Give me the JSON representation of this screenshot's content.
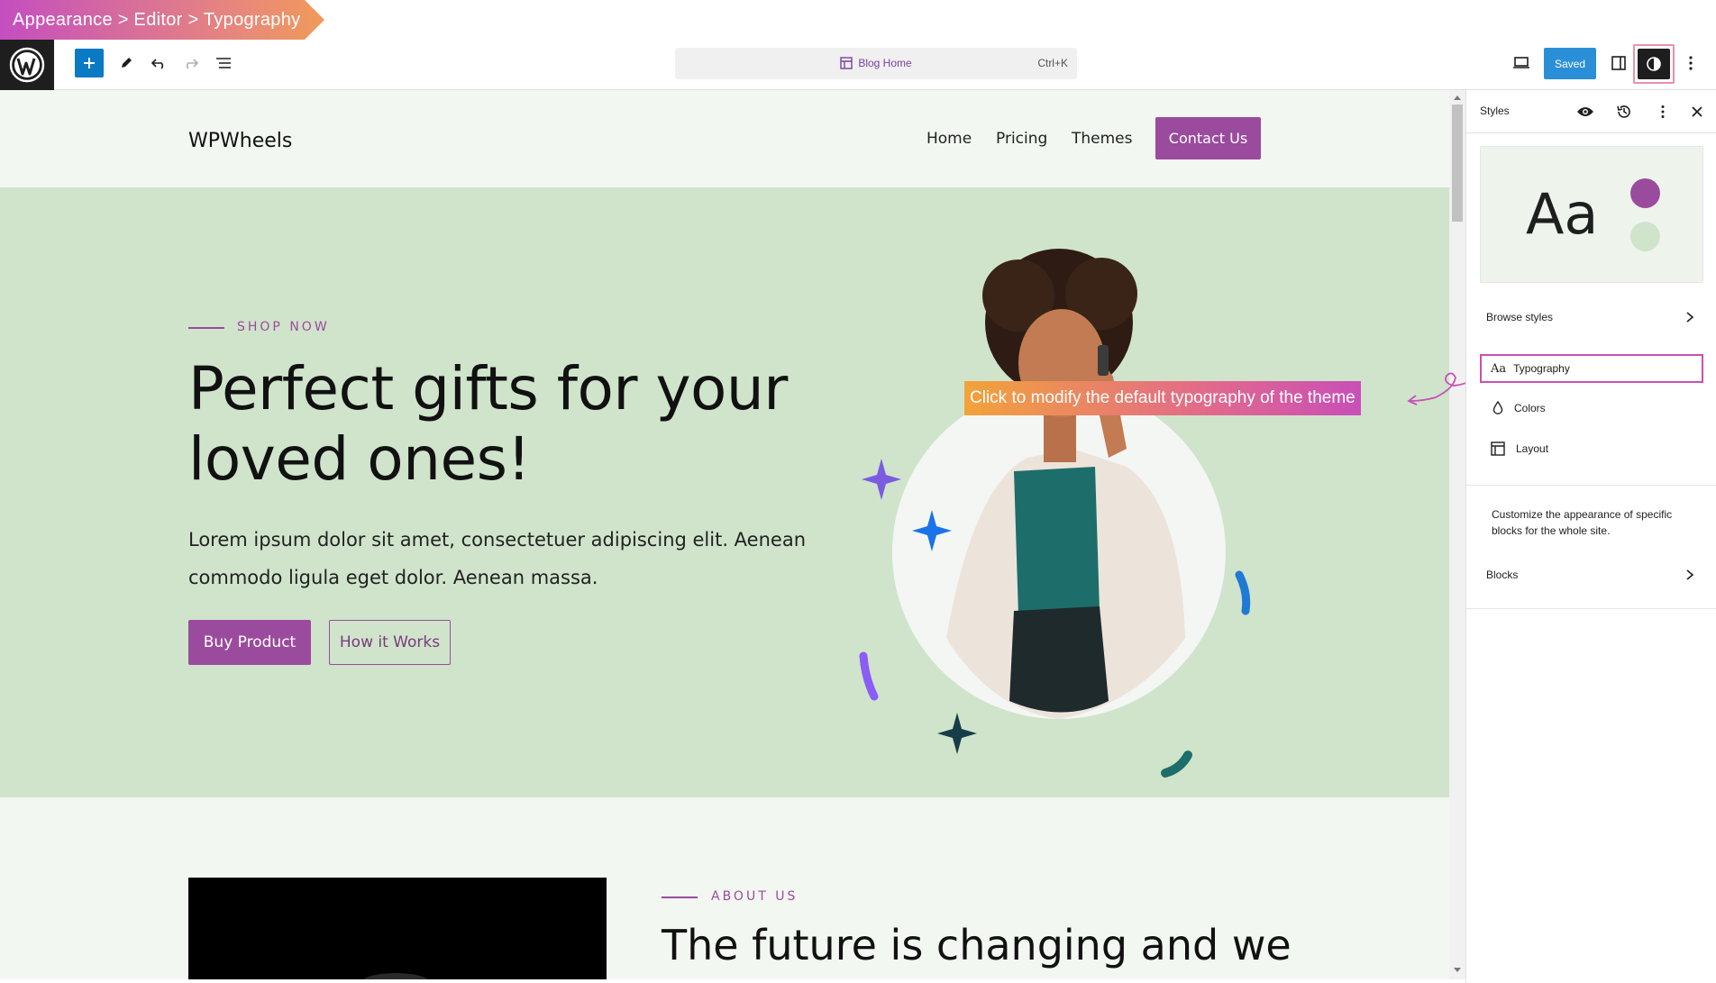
{
  "breadcrumb": {
    "text": "Appearance > Editor > Typography"
  },
  "toolbar": {
    "add_icon": "plus-icon",
    "tools_icon": "pencil-icon",
    "undo_icon": "undo-icon",
    "redo_icon": "redo-icon",
    "list_view_icon": "list-view-icon",
    "document_title": "Blog Home",
    "shortcut": "Ctrl+K",
    "saved_label": "Saved",
    "accent": "#0a7ac4"
  },
  "site": {
    "title": "WPWheels",
    "nav": [
      "Home",
      "Pricing",
      "Themes"
    ],
    "contact_label": "Contact Us"
  },
  "hero": {
    "kicker": "SHOP NOW",
    "title": "Perfect gifts for your loved ones!",
    "text": "Lorem ipsum dolor sit amet, consectetuer adipiscing elit. Aenean commodo ligula eget dolor. Aenean massa.",
    "primary_button": "Buy Product",
    "secondary_button": "How it Works",
    "bg_color": "#cfe4cb",
    "brand_color": "#9b4b9e"
  },
  "about": {
    "kicker": "ABOUT US",
    "title": "The future is changing and we"
  },
  "tooltip": {
    "text": "Click to modify the default typography of the theme"
  },
  "sidebar": {
    "title": "Styles",
    "preview_text": "Aa",
    "browse_styles": "Browse styles",
    "items": [
      {
        "label": "Typography",
        "icon": "typography-icon"
      },
      {
        "label": "Colors",
        "icon": "droplet-icon"
      },
      {
        "label": "Layout",
        "icon": "layout-icon"
      }
    ],
    "description": "Customize the appearance of specific blocks for the whole site.",
    "blocks": "Blocks"
  }
}
